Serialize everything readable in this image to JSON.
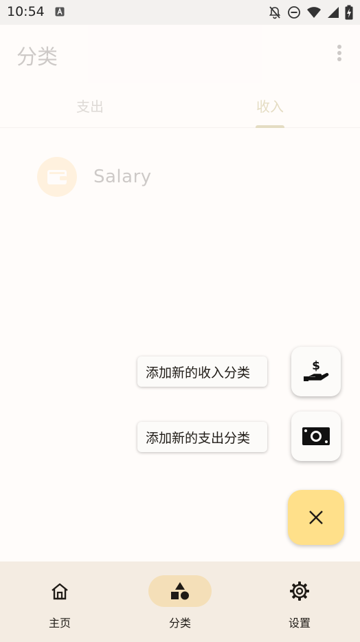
{
  "status_bar": {
    "time": "10:54",
    "icons": [
      "notification-icon",
      "bell-off-icon",
      "do-not-disturb-icon",
      "wifi-icon",
      "signal-icon",
      "battery-charging-icon"
    ]
  },
  "app_bar": {
    "title": "分类",
    "menu_icon": "more-vert-icon"
  },
  "tabs": [
    {
      "label": "支出",
      "selected": false
    },
    {
      "label": "收入",
      "selected": true
    }
  ],
  "categories": [
    {
      "label": "Salary",
      "icon": "wallet-icon",
      "color": "#ffcc80"
    }
  ],
  "fab_menu": {
    "expanded": true,
    "actions": [
      {
        "label": "添加新的收入分类",
        "icon": "hand-dollar-icon"
      },
      {
        "label": "添加新的支出分类",
        "icon": "money-bill-icon"
      }
    ],
    "close_icon": "close-icon"
  },
  "bottom_nav": {
    "items": [
      {
        "label": "主页",
        "icon": "home-icon",
        "active": false
      },
      {
        "label": "分类",
        "icon": "category-icon",
        "active": true
      },
      {
        "label": "设置",
        "icon": "gear-icon",
        "active": false
      }
    ]
  },
  "colors": {
    "background": "#fffcfa",
    "accent": "#8a6d00",
    "fab": "#ffe08a",
    "nav_background": "#f4ece2",
    "nav_active_pill": "#f4dfb8"
  }
}
